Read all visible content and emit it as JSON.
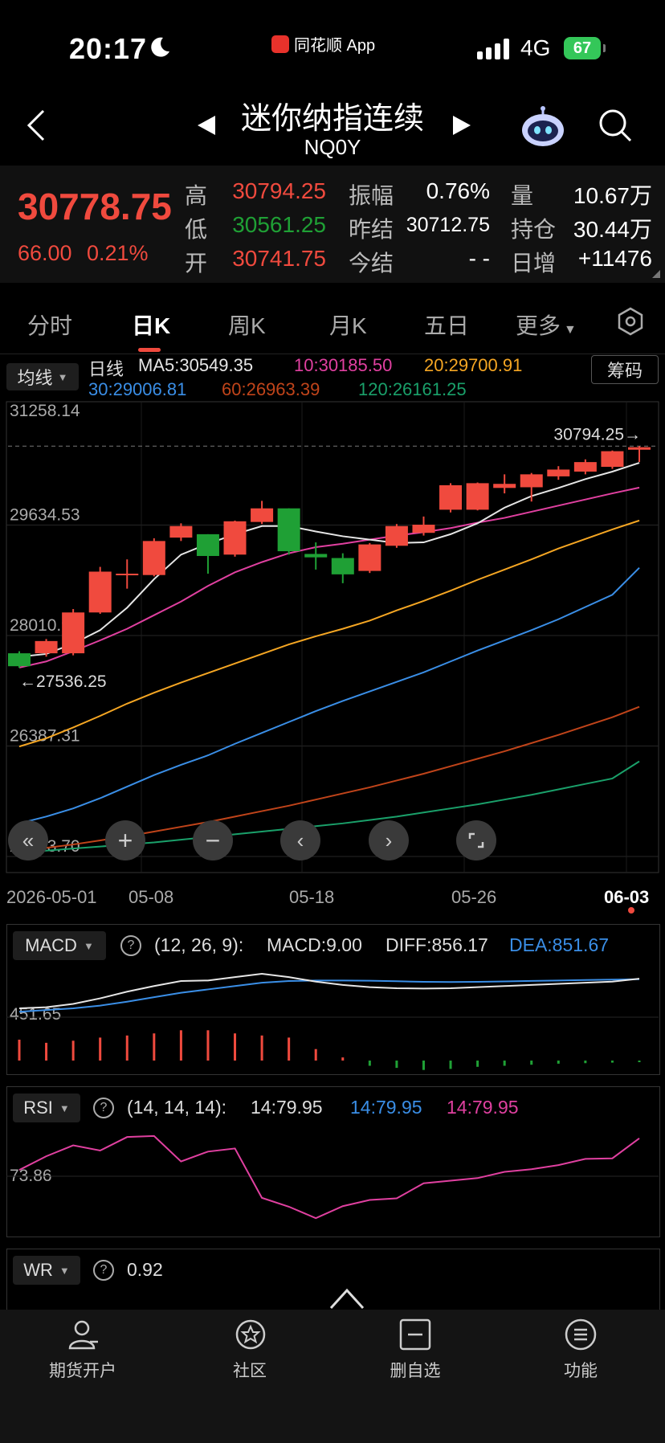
{
  "status": {
    "time": "20:17",
    "app_badge": "同花顺 App",
    "network": "4G",
    "battery": "67"
  },
  "nav": {
    "title": "迷你纳指连续",
    "subtitle": "NQ0Y"
  },
  "quote": {
    "price": "30778.75",
    "change": "66.00",
    "change_pct": "0.21%",
    "high_label": "高",
    "high": "30794.25",
    "low_label": "低",
    "low": "30561.25",
    "open_label": "开",
    "open": "30741.75",
    "amp_label": "振幅",
    "amp": "0.76%",
    "prevsettle_label": "昨结",
    "prevsettle": "30712.75",
    "settle_label": "今结",
    "settle": "- -",
    "vol_label": "量",
    "vol": "10.67万",
    "oi_label": "持仓",
    "oi": "30.44万",
    "daily_label": "日增",
    "daily": "+11476"
  },
  "tabs": [
    {
      "label": "分时"
    },
    {
      "label": "日K"
    },
    {
      "label": "周K"
    },
    {
      "label": "月K"
    },
    {
      "label": "五日"
    },
    {
      "label": "更多"
    }
  ],
  "indicator": {
    "ma_button": "均线",
    "chip_button": "筹码",
    "period": "日线",
    "ma5": "MA5:30549.35",
    "ma10": "10:30185.50",
    "ma20": "20:29700.91",
    "ma30": "30:29006.81",
    "ma60": "60:26963.39",
    "ma120": "120:26161.25"
  },
  "colors": {
    "up": "#f04a3e",
    "down": "#1fa035",
    "ma5": "#e6e6e6",
    "ma10": "#e040a0",
    "ma20": "#f5a623",
    "ma30": "#3a8ee6",
    "ma60": "#c0441a",
    "ma120": "#1aa06a"
  },
  "chart_data": {
    "type": "candlestick",
    "yticks": [
      "31258.14",
      "29634.53",
      "28010.92",
      "26387.31",
      "24763.70"
    ],
    "ylim": [
      24763.7,
      31258.14
    ],
    "high_marker": "30794.25→",
    "low_marker": "←27536.25",
    "xticks": [
      "2026-05-01",
      "05-08",
      "05-18",
      "05-26",
      "06-03"
    ],
    "candles": [
      {
        "o": 27750,
        "c": 27560,
        "h": 27780,
        "l": 27536.25
      },
      {
        "o": 27750,
        "c": 27930,
        "h": 27960,
        "l": 27700
      },
      {
        "o": 27750,
        "c": 28350,
        "h": 28400,
        "l": 27720
      },
      {
        "o": 28350,
        "c": 28950,
        "h": 29020,
        "l": 28330
      },
      {
        "o": 28900,
        "c": 28920,
        "h": 29130,
        "l": 28700
      },
      {
        "o": 28900,
        "c": 29400,
        "h": 29440,
        "l": 28880
      },
      {
        "o": 29450,
        "c": 29620,
        "h": 29660,
        "l": 29400
      },
      {
        "o": 29500,
        "c": 29180,
        "h": 29500,
        "l": 28920
      },
      {
        "o": 29200,
        "c": 29690,
        "h": 29700,
        "l": 29170
      },
      {
        "o": 29680,
        "c": 29880,
        "h": 29990,
        "l": 29650
      },
      {
        "o": 29880,
        "c": 29250,
        "h": 29880,
        "l": 29200
      },
      {
        "o": 29210,
        "c": 29160,
        "h": 29380,
        "l": 28980
      },
      {
        "o": 29150,
        "c": 28910,
        "h": 29220,
        "l": 28780
      },
      {
        "o": 28960,
        "c": 29350,
        "h": 29370,
        "l": 28930
      },
      {
        "o": 29330,
        "c": 29620,
        "h": 29650,
        "l": 29300
      },
      {
        "o": 29520,
        "c": 29640,
        "h": 29760,
        "l": 29480
      },
      {
        "o": 29860,
        "c": 30220,
        "h": 30250,
        "l": 29820
      },
      {
        "o": 29860,
        "c": 30250,
        "h": 30260,
        "l": 29850
      },
      {
        "o": 30180,
        "c": 30240,
        "h": 30380,
        "l": 30100
      },
      {
        "o": 30190,
        "c": 30380,
        "h": 30400,
        "l": 29980
      },
      {
        "o": 30350,
        "c": 30450,
        "h": 30500,
        "l": 30300
      },
      {
        "o": 30420,
        "c": 30560,
        "h": 30600,
        "l": 30380
      },
      {
        "o": 30490,
        "c": 30720,
        "h": 30730,
        "l": 30460
      },
      {
        "o": 30741.75,
        "c": 30778.75,
        "h": 30794.25,
        "l": 30561.25
      }
    ],
    "ma5": [
      27700,
      27740,
      27890,
      28090,
      28420,
      28840,
      29200,
      29360,
      29500,
      29620,
      29620,
      29540,
      29470,
      29420,
      29370,
      29380,
      29500,
      29660,
      29890,
      30060,
      30180,
      30310,
      30420,
      30549.35
    ],
    "ma10": [
      27540,
      27630,
      27780,
      27940,
      28110,
      28310,
      28510,
      28740,
      28940,
      29090,
      29220,
      29310,
      29360,
      29420,
      29480,
      29530,
      29590,
      29670,
      29740,
      29830,
      29920,
      30010,
      30100,
      30185.5
    ],
    "ma20": [
      26380,
      26500,
      26660,
      26830,
      27010,
      27170,
      27320,
      27460,
      27600,
      27740,
      27880,
      28000,
      28110,
      28230,
      28380,
      28520,
      28670,
      28830,
      28980,
      29130,
      29290,
      29430,
      29570,
      29700.91
    ],
    "ma30": [
      25250,
      25350,
      25470,
      25620,
      25790,
      25960,
      26110,
      26250,
      26420,
      26580,
      26740,
      26900,
      27050,
      27190,
      27330,
      27470,
      27630,
      27790,
      27940,
      28090,
      28250,
      28430,
      28610,
      29006.81
    ],
    "ma60": [
      24850,
      24890,
      24940,
      25000,
      25060,
      25130,
      25200,
      25270,
      25350,
      25430,
      25510,
      25600,
      25690,
      25780,
      25880,
      25980,
      26090,
      26200,
      26310,
      26430,
      26550,
      26680,
      26810,
      26963.39
    ],
    "ma120": [
      24820,
      24850,
      24880,
      24910,
      24940,
      24970,
      25010,
      25050,
      25090,
      25130,
      25170,
      25210,
      25250,
      25300,
      25350,
      25410,
      25470,
      25530,
      25600,
      25670,
      25750,
      25830,
      25910,
      26161.25
    ]
  },
  "macd": {
    "selector": "MACD",
    "params": "(12, 26, 9):",
    "macd": "MACD:9.00",
    "diff": "DIFF:856.17",
    "dea": "DEA:851.67",
    "ytick": "451.65",
    "hist": [
      40,
      34,
      38,
      44,
      48,
      52,
      58,
      58,
      52,
      48,
      44,
      22,
      6,
      -10,
      -14,
      -18,
      -16,
      -12,
      -10,
      -8,
      -6,
      -5,
      -4,
      -3
    ],
    "diff_line": [
      590,
      600,
      630,
      680,
      740,
      790,
      835,
      840,
      870,
      900,
      870,
      830,
      800,
      780,
      770,
      768,
      770,
      780,
      790,
      800,
      810,
      820,
      830,
      856.17
    ],
    "dea_line": [
      560,
      575,
      590,
      615,
      650,
      690,
      730,
      760,
      790,
      820,
      835,
      840,
      840,
      838,
      833,
      828,
      826,
      828,
      832,
      836,
      840,
      844,
      848,
      851.67
    ]
  },
  "rsi": {
    "selector": "RSI",
    "params": "(14, 14, 14):",
    "r1": "14:79.95",
    "r2": "14:79.95",
    "r3": "14:79.95",
    "ytick": "73.86",
    "values": [
      73.86,
      76.5,
      78.6,
      77.6,
      80.2,
      80.4,
      75.5,
      77.4,
      78.0,
      68.5,
      66.8,
      64.6,
      66.9,
      68.1,
      68.4,
      71.3,
      71.8,
      72.3,
      73.5,
      74.0,
      74.8,
      76.0,
      76.1,
      79.95
    ]
  },
  "wr": {
    "selector": "WR",
    "value": "0.92"
  },
  "bottom_nav": [
    {
      "label": "期货开户"
    },
    {
      "label": "社区"
    },
    {
      "label": "删自选"
    },
    {
      "label": "功能"
    }
  ]
}
